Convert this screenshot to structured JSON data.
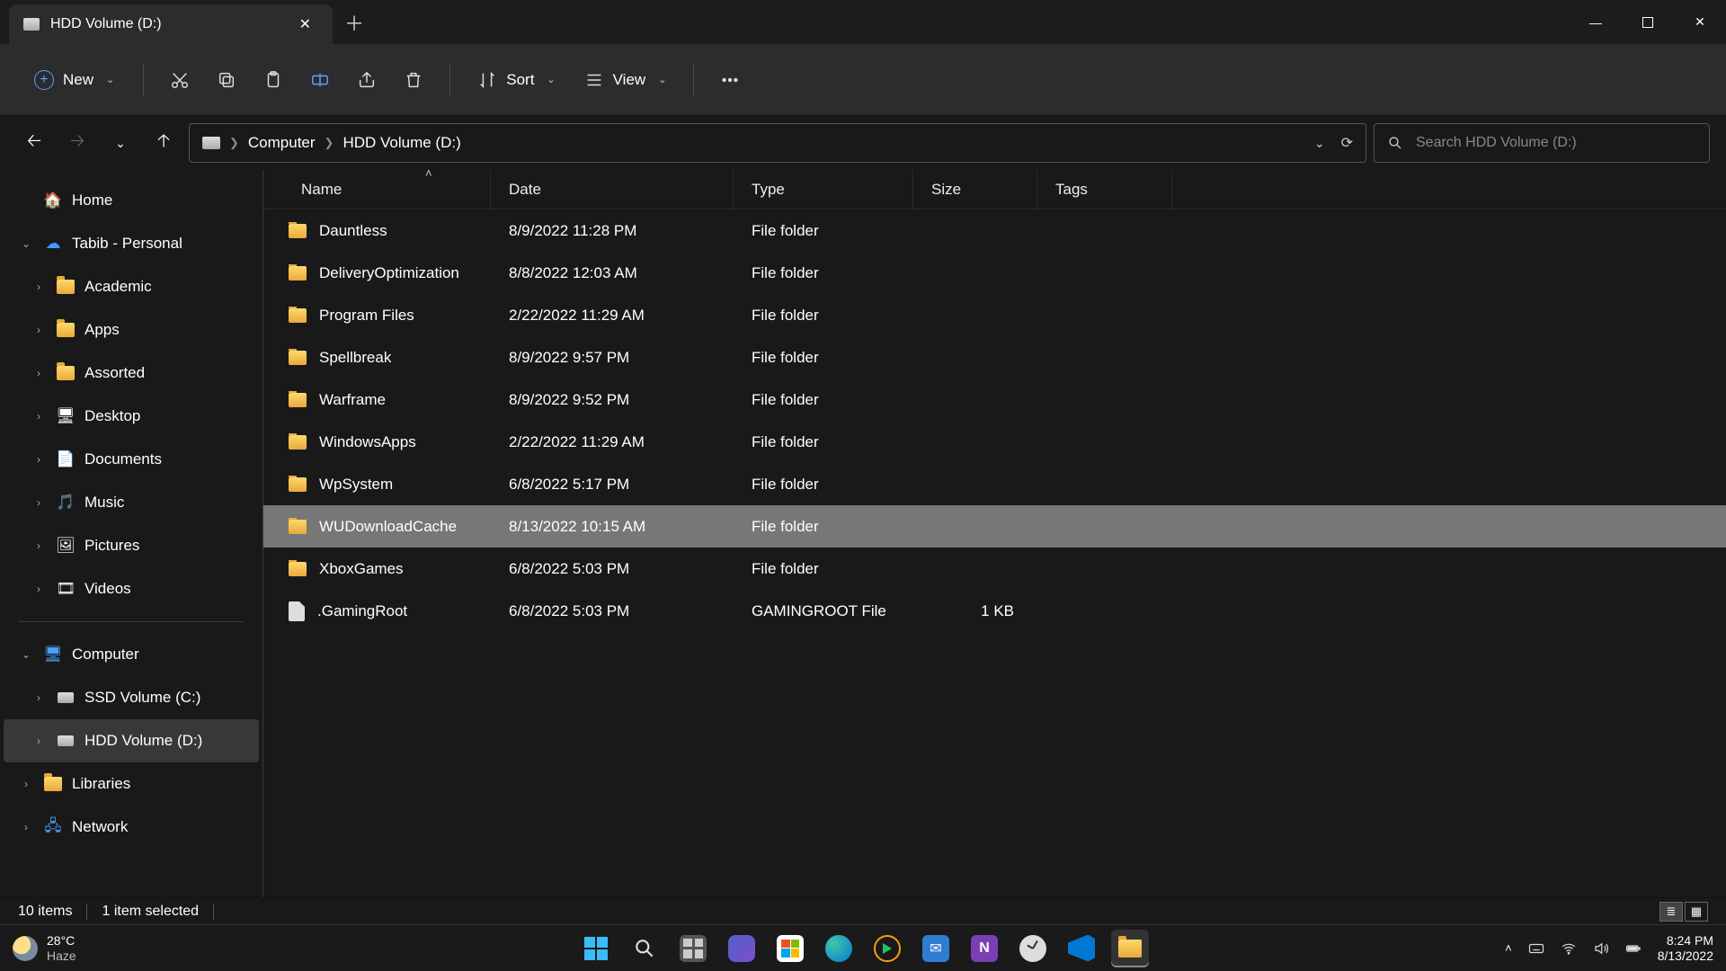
{
  "tab": {
    "title": "HDD Volume (D:)"
  },
  "toolbar": {
    "new": "New",
    "sort": "Sort",
    "view": "View"
  },
  "breadcrumb": {
    "root": "Computer",
    "current": "HDD Volume (D:)"
  },
  "search": {
    "placeholder": "Search HDD Volume (D:)"
  },
  "sidebar": {
    "home": "Home",
    "cloud": "Tabib - Personal",
    "items": [
      "Academic",
      "Apps",
      "Assorted",
      "Desktop",
      "Documents",
      "Music",
      "Pictures",
      "Videos"
    ],
    "computer": "Computer",
    "drives": [
      "SSD Volume (C:)",
      "HDD Volume (D:)"
    ],
    "libraries": "Libraries",
    "network": "Network"
  },
  "columns": {
    "name": "Name",
    "date": "Date",
    "type": "Type",
    "size": "Size",
    "tags": "Tags"
  },
  "rows": [
    {
      "name": "Dauntless",
      "date": "8/9/2022 11:28 PM",
      "type": "File folder",
      "size": "",
      "icon": "folder"
    },
    {
      "name": "DeliveryOptimization",
      "date": "8/8/2022 12:03 AM",
      "type": "File folder",
      "size": "",
      "icon": "folder"
    },
    {
      "name": "Program Files",
      "date": "2/22/2022 11:29 AM",
      "type": "File folder",
      "size": "",
      "icon": "folder"
    },
    {
      "name": "Spellbreak",
      "date": "8/9/2022 9:57 PM",
      "type": "File folder",
      "size": "",
      "icon": "folder"
    },
    {
      "name": "Warframe",
      "date": "8/9/2022 9:52 PM",
      "type": "File folder",
      "size": "",
      "icon": "folder"
    },
    {
      "name": "WindowsApps",
      "date": "2/22/2022 11:29 AM",
      "type": "File folder",
      "size": "",
      "icon": "folder"
    },
    {
      "name": "WpSystem",
      "date": "6/8/2022 5:17 PM",
      "type": "File folder",
      "size": "",
      "icon": "folder"
    },
    {
      "name": "WUDownloadCache",
      "date": "8/13/2022 10:15 AM",
      "type": "File folder",
      "size": "",
      "icon": "folder",
      "selected": true
    },
    {
      "name": "XboxGames",
      "date": "6/8/2022 5:03 PM",
      "type": "File folder",
      "size": "",
      "icon": "folder"
    },
    {
      "name": ".GamingRoot",
      "date": "6/8/2022 5:03 PM",
      "type": "GAMINGROOT File",
      "size": "1 KB",
      "icon": "file"
    }
  ],
  "status": {
    "count": "10 items",
    "selection": "1 item selected"
  },
  "weather": {
    "temp": "28°C",
    "cond": "Haze"
  },
  "clock": {
    "time": "8:24 PM",
    "date": "8/13/2022"
  }
}
